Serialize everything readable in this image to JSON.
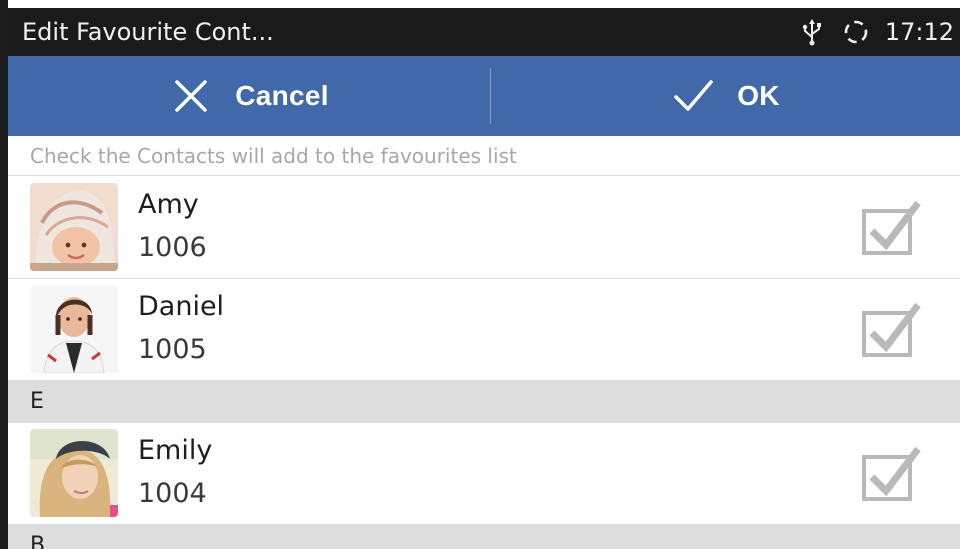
{
  "status_bar": {
    "title": "Edit Favourite Cont...",
    "time": "17:12",
    "icons": [
      "usb-icon",
      "sync-icon"
    ]
  },
  "action_bar": {
    "cancel_label": "Cancel",
    "ok_label": "OK",
    "cancel_icon": "close-icon",
    "ok_icon": "check-icon"
  },
  "hint": "Check the Contacts will add to the favourites list",
  "contacts": [
    {
      "name": "Amy",
      "number": "1006",
      "checked": true
    },
    {
      "name": "Daniel",
      "number": "1005",
      "checked": true
    },
    {
      "name": "Emily",
      "number": "1004",
      "checked": true
    }
  ],
  "sections": [
    "E",
    "B"
  ],
  "colors": {
    "action_bar": "#4169a9",
    "status_bar": "#1a1a1a",
    "section_header": "#dddddd",
    "checkbox": "#b9b9b9"
  }
}
